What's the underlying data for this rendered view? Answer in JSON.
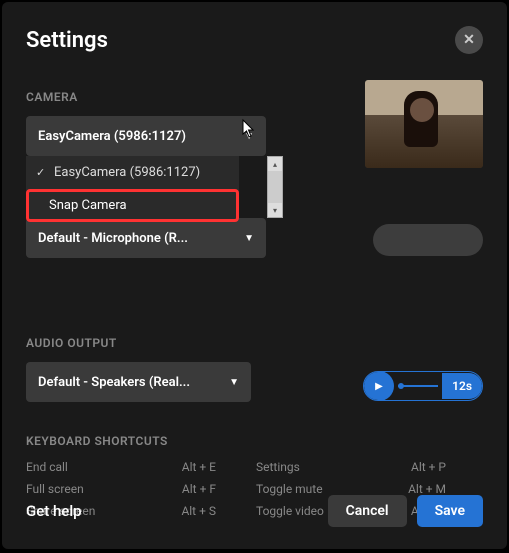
{
  "header": {
    "title": "Settings"
  },
  "camera": {
    "section_label": "CAMERA",
    "selected": "EasyCamera (5986:1127)",
    "options": [
      {
        "label": "EasyCamera (5986:1127)",
        "checked": true
      },
      {
        "label": "Snap Camera",
        "checked": false
      }
    ]
  },
  "microphone": {
    "selected": "Default - Microphone (R..."
  },
  "audio_output": {
    "section_label": "AUDIO OUTPUT",
    "selected": "Default - Speakers (Real...",
    "time": "12s"
  },
  "shortcuts": {
    "section_label": "KEYBOARD SHORTCUTS",
    "left": [
      {
        "label": "End call",
        "key": "Alt + E"
      },
      {
        "label": "Full screen",
        "key": "Alt + F"
      },
      {
        "label": "Share screen",
        "key": "Alt + S"
      }
    ],
    "right": [
      {
        "label": "Settings",
        "key": "Alt + P"
      },
      {
        "label": "Toggle mute",
        "key": "Alt + M"
      },
      {
        "label": "Toggle video",
        "key": "Alt + V"
      }
    ]
  },
  "footer": {
    "help": "Get help",
    "cancel": "Cancel",
    "save": "Save"
  }
}
